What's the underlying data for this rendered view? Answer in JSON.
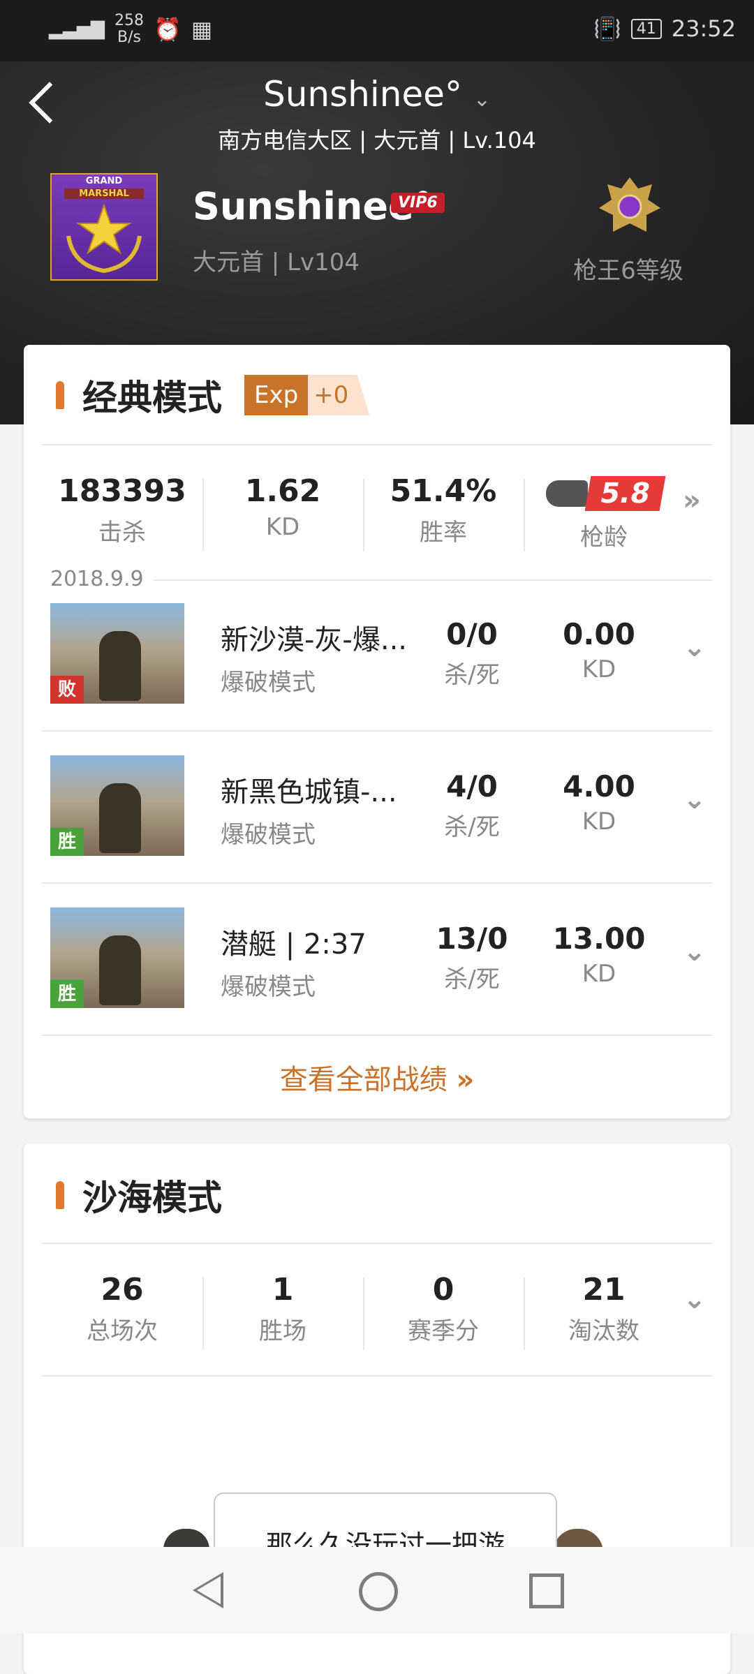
{
  "status_bar": {
    "network": "4G",
    "speed": "258",
    "speed_unit": "B/s",
    "battery": "41",
    "time": "23:52"
  },
  "header": {
    "title": "Sunshinee°",
    "subtitle": "南方电信大区 | 大元首 | Lv.104"
  },
  "profile": {
    "avatar_text_top": "GRAND",
    "avatar_text_bottom": "MARSHAL",
    "name": "Sunshinee°",
    "vip_badge": "VIP6",
    "meta": "大元首 | Lv104",
    "rank_label": "枪王6等级"
  },
  "classic": {
    "title": "经典模式",
    "exp_label": "Exp",
    "exp_value": "+0",
    "stats": [
      {
        "value": "183393",
        "label": "击杀"
      },
      {
        "value": "1.62",
        "label": "KD"
      },
      {
        "value": "51.4%",
        "label": "胜率"
      },
      {
        "value": "5.8",
        "label": "枪龄"
      }
    ],
    "date": "2018.9.9",
    "matches": [
      {
        "map": "新沙漠-灰-爆...",
        "mode": "爆破模式",
        "result": "败",
        "kills_deaths": "0/0",
        "kd_label": "杀/死",
        "kd": "0.00",
        "kd_unit": "KD"
      },
      {
        "map": "新黑色城镇-...",
        "mode": "爆破模式",
        "result": "胜",
        "kills_deaths": "4/0",
        "kd_label": "杀/死",
        "kd": "4.00",
        "kd_unit": "KD"
      },
      {
        "map": "潜艇 | 2:37",
        "mode": "爆破模式",
        "result": "胜",
        "kills_deaths": "13/0",
        "kd_label": "杀/死",
        "kd": "13.00",
        "kd_unit": "KD"
      }
    ],
    "view_all": "查看全部战绩"
  },
  "sandsea": {
    "title": "沙海模式",
    "stats": [
      {
        "value": "26",
        "label": "总场次"
      },
      {
        "value": "1",
        "label": "胜场"
      },
      {
        "value": "0",
        "label": "赛季分"
      },
      {
        "value": "21",
        "label": "淘汰数"
      }
    ]
  },
  "dialog": {
    "text": "那么久没玩过一把游"
  },
  "colors": {
    "accent": "#c9732a",
    "loss": "#d0342c",
    "win": "#4aa33a",
    "gun_badge": "#e63a3a"
  }
}
